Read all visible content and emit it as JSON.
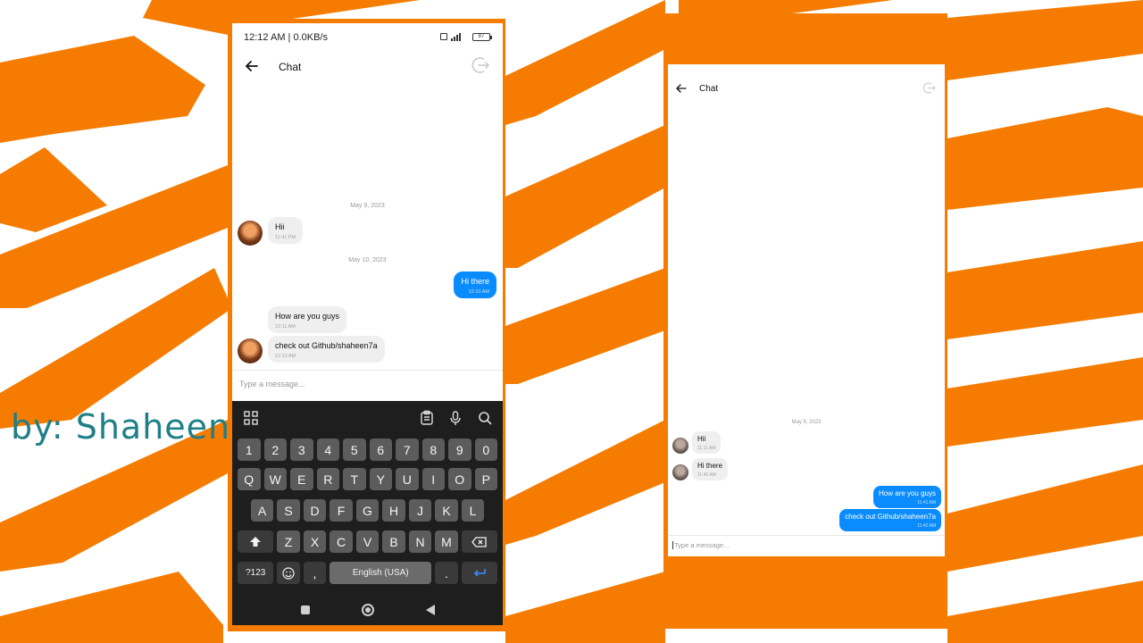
{
  "byline": "by: Shaheen",
  "colors": {
    "accent_orange": "#f57c00",
    "sent_bubble": "#0a8cff",
    "received_bubble": "#efefef",
    "byline": "#1f7f86"
  },
  "phone_keyboard": {
    "status_bar": {
      "time": "12:12 AM | 0.0KB/s",
      "battery": "87"
    },
    "header": {
      "title": "Chat",
      "back_icon": "arrow-left-icon",
      "exit_icon": "logout-icon"
    },
    "date_separators": [
      "May 9, 2023",
      "May 10, 2023"
    ],
    "messages": [
      {
        "text": "Hii",
        "time": "11:41 PM",
        "direction": "received"
      },
      {
        "text": "Hi there",
        "time": "12:10 AM",
        "direction": "sent"
      },
      {
        "text": "How are you guys",
        "time": "12:11 AM",
        "direction": "received"
      },
      {
        "text": "check out Github/shaheen7a",
        "time": "12:12 AM",
        "direction": "received"
      }
    ],
    "input": {
      "placeholder": "Type a message..."
    },
    "keyboard": {
      "toolbar_icons": [
        "grid-icon",
        "clipboard-icon",
        "microphone-icon",
        "search-icon"
      ],
      "row_numbers": [
        "1",
        "2",
        "3",
        "4",
        "5",
        "6",
        "7",
        "8",
        "9",
        "0"
      ],
      "row_q": [
        "Q",
        "W",
        "E",
        "R",
        "T",
        "Y",
        "U",
        "I",
        "O",
        "P"
      ],
      "row_a": [
        "A",
        "S",
        "D",
        "F",
        "G",
        "H",
        "J",
        "K",
        "L"
      ],
      "row_z": [
        "Z",
        "X",
        "C",
        "V",
        "B",
        "N",
        "M"
      ],
      "symbols_key": "?123",
      "comma_key": ",",
      "space_label": "English (USA)",
      "period_key": "."
    }
  },
  "phone_browser": {
    "header": {
      "title": "Chat",
      "back_icon": "arrow-left-icon",
      "exit_icon": "logout-icon"
    },
    "date_separators": [
      "May 9, 2023"
    ],
    "messages": [
      {
        "text": "Hii",
        "time": "11:11 AM",
        "direction": "received"
      },
      {
        "text": "Hi there",
        "time": "11:40 AM",
        "direction": "received"
      },
      {
        "text": "How are you guys",
        "time": "11:41 AM",
        "direction": "sent"
      },
      {
        "text": "check out Github/shaheen7a",
        "time": "11:42 AM",
        "direction": "sent"
      }
    ],
    "input": {
      "placeholder": "Type a message..."
    }
  }
}
